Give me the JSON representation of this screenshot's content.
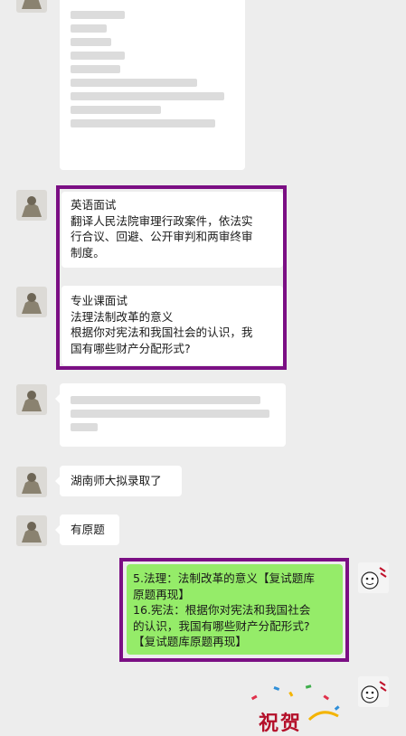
{
  "messages": {
    "english_title": "英语面试",
    "english_body_line1": "翻译人民法院审理行政案件，依法实",
    "english_body_line2": "行合议、回避、公开审判和两审终审",
    "english_body_line3": "制度。",
    "major_title": "专业课面试",
    "major_line1": "法理法制改革的意义",
    "major_line2": "根据你对宪法和我国社会的认识，我",
    "major_line3": "国有哪些财产分配形式?",
    "admit": "湖南师大拟录取了",
    "original_q": "有原题",
    "reply_line1": "5.法理：法制改革的意义【复试题库",
    "reply_line2": "原题再现】",
    "reply_line3": "16.宪法：根据你对宪法和我国社会",
    "reply_line4": "的认识，我国有哪些财产分配形式?",
    "reply_line5": "【复试题库原题再现】"
  },
  "sticker": {
    "text": "祝贺"
  },
  "colors": {
    "background": "#ededed",
    "bubble_received": "#ffffff",
    "bubble_sent": "#95ec69",
    "highlight_frame": "#7b0f84"
  },
  "icons": [
    "avatar-bull-icon",
    "avatar-sticker-icon"
  ]
}
